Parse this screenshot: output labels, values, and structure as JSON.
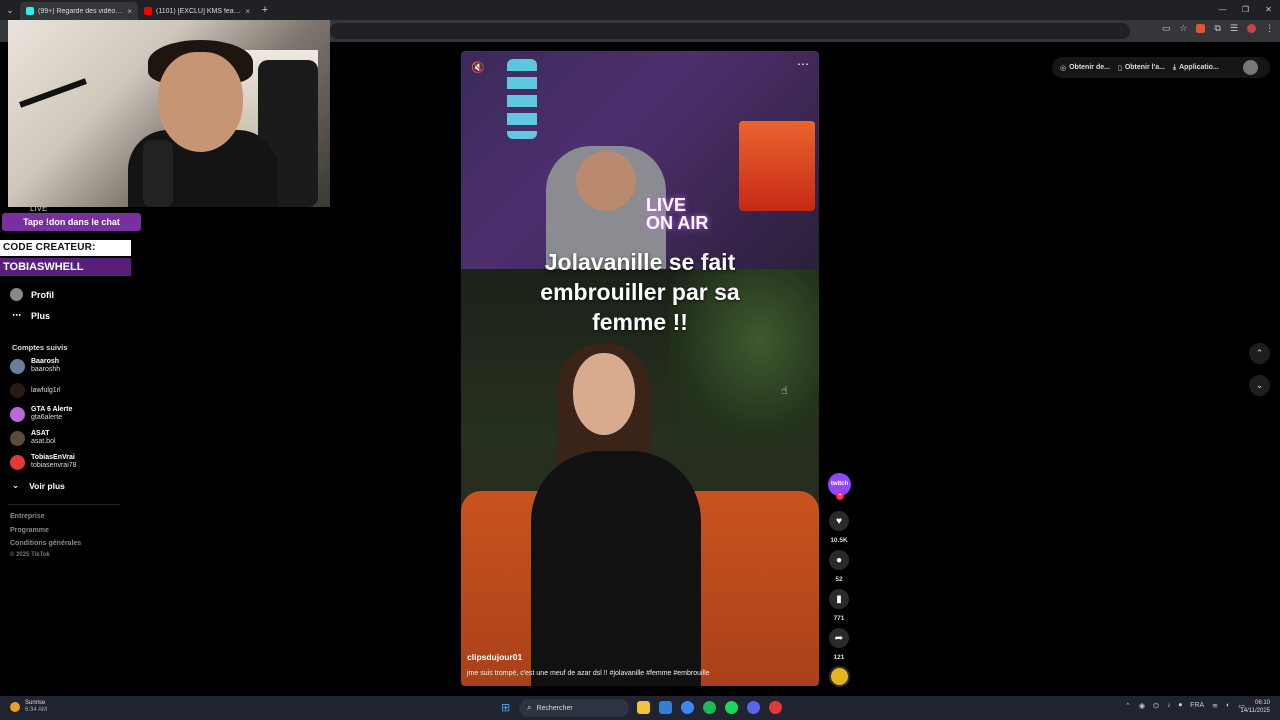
{
  "browser": {
    "tabs": [
      {
        "title": "(99+) Regarde des vidéos tendance",
        "active": true,
        "favicon_color": "#25f4ee"
      },
      {
        "title": "(1101) [EXCLU] KMS feat. 2V - ...",
        "active": false,
        "favicon_color": "#ff0000"
      }
    ],
    "new_tab": "+",
    "close": "×"
  },
  "overlay": {
    "tape_badge": "Tape !don dans le chat",
    "code_line1": "CODE CREATEUR:",
    "code_line2": "TOBIASWHELL",
    "live_fragment": "LIVE"
  },
  "sidebar": {
    "profile_label": "Profil",
    "more_label": "Plus",
    "followed_title": "Comptes suivis",
    "accounts": [
      {
        "name": "Baarosh",
        "handle": "baaroshh",
        "color": "#6a7f9c"
      },
      {
        "name": "",
        "handle": "lawfulg1rl",
        "color": "#2a1a16"
      },
      {
        "name": "GTA 6 Alerte",
        "handle": "gta6alerte",
        "color": "#b86bd6"
      },
      {
        "name": "ASAT",
        "handle": "asat.bol",
        "color": "#5c4a3a"
      },
      {
        "name": "TobiasEnVrai",
        "handle": "tobiasenvrai78",
        "color": "#e23a3a"
      }
    ],
    "see_more": "Voir plus",
    "footer": [
      "Entreprise",
      "Programme",
      "Conditions générales"
    ],
    "copyright": "© 2025 TikTok"
  },
  "video": {
    "caption": "Jolavanille se fait embrouiller par sa femme !!",
    "neon_text": "LIVE\nON AIR",
    "username": "clipsdujour01",
    "description": "jme suis trompé, c'est une meuf de azar dsl !! #jolavanille #femme #embrouille"
  },
  "actions": {
    "creator_label": "twitch",
    "likes": "10.5K",
    "comments": "52",
    "saves": "771",
    "shares": "121"
  },
  "chips": [
    "Obtenir de...",
    "Obtenir l'a...",
    "Applicatio..."
  ],
  "taskbar": {
    "weather_title": "Sunrise",
    "weather_time": "6:34 AM",
    "search_label": "Rechercher",
    "lang": "FRA",
    "time": "06:10",
    "date": "14/11/2025",
    "app_colors": [
      "#f3c33a",
      "#3a7bd5",
      "#1db954",
      "#1ed760",
      "#5865f2",
      "#e23a3a",
      "#4285f4"
    ]
  }
}
